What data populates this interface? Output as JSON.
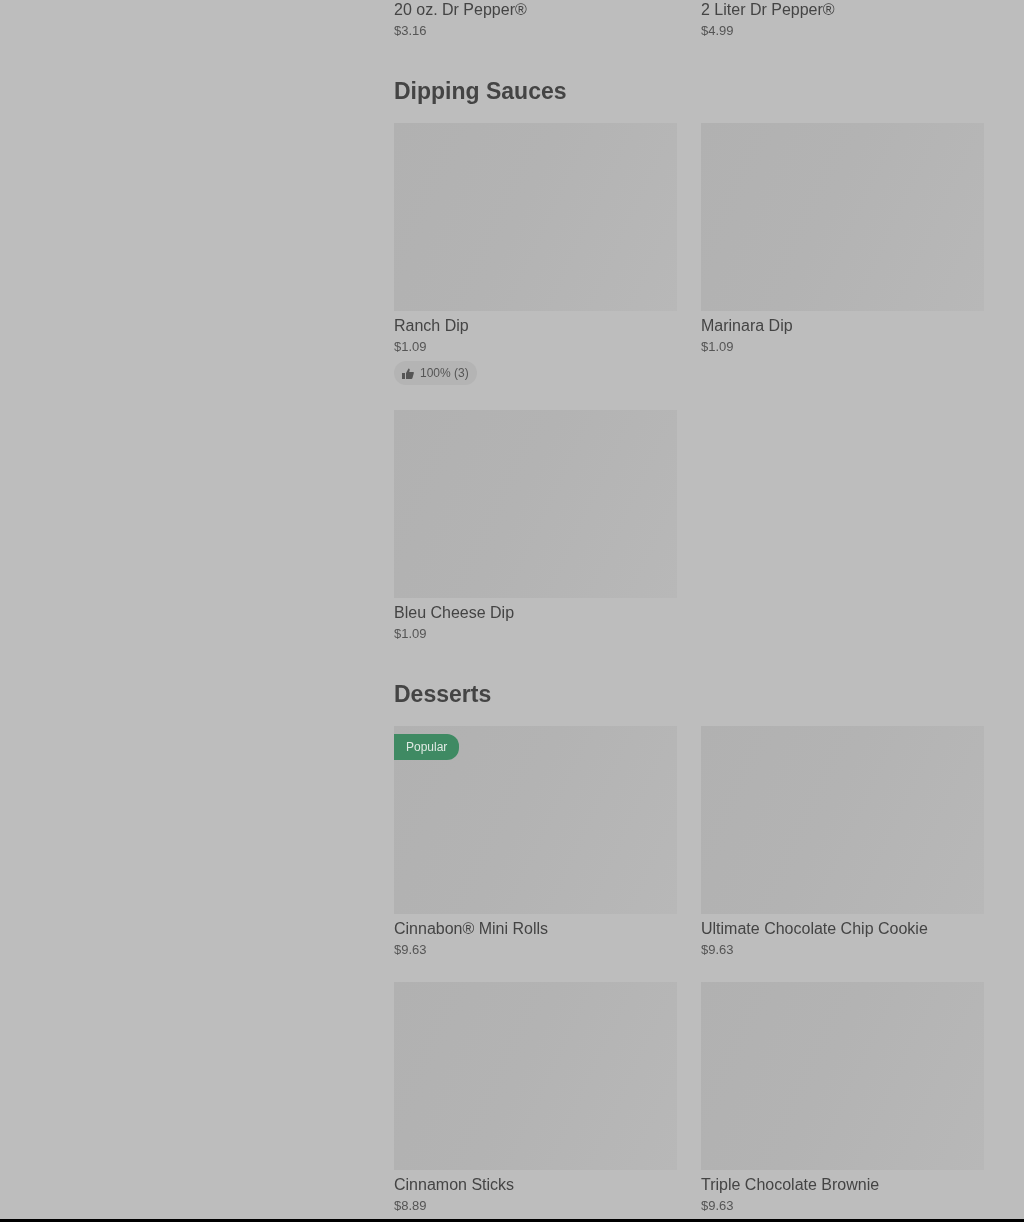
{
  "partial_items": [
    {
      "name": "20 oz. Dr Pepper®",
      "price": "$3.16"
    },
    {
      "name": "2 Liter Dr Pepper®",
      "price": "$4.99"
    }
  ],
  "sections": [
    {
      "title": "Dipping Sauces",
      "items": [
        {
          "name": "Ranch Dip",
          "price": "$1.09",
          "rating": "100% (3)"
        },
        {
          "name": "Marinara Dip",
          "price": "$1.09"
        },
        {
          "name": "Bleu Cheese Dip",
          "price": "$1.09"
        }
      ]
    },
    {
      "title": "Desserts",
      "items": [
        {
          "name": "Cinnabon® Mini Rolls",
          "price": "$9.63",
          "badge": "Popular"
        },
        {
          "name": "Ultimate Chocolate Chip Cookie",
          "price": "$9.63"
        },
        {
          "name": "Cinnamon Sticks",
          "price": "$8.89"
        },
        {
          "name": "Triple Chocolate Brownie",
          "price": "$9.63"
        }
      ]
    }
  ]
}
